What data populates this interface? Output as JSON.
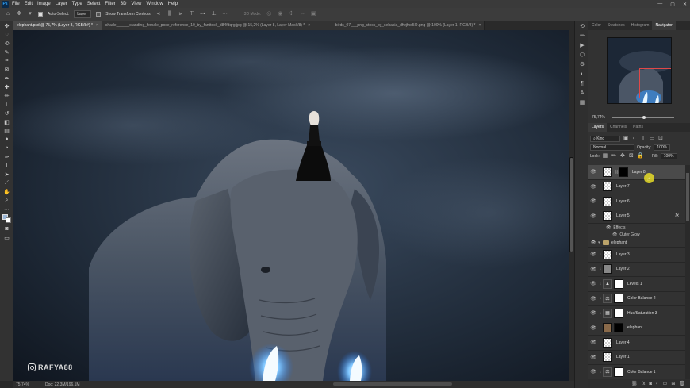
{
  "menubar": {
    "logo": "Ps",
    "items": [
      "File",
      "Edit",
      "Image",
      "Layer",
      "Type",
      "Select",
      "Filter",
      "3D",
      "View",
      "Window",
      "Help"
    ],
    "window_controls": [
      "—",
      "▢",
      "✕"
    ]
  },
  "options": {
    "auto_select_label": "Auto-Select:",
    "auto_select_target": "Layer",
    "show_transform_label": "Show Transform Controls",
    "mode_3d_label": "3D Mode:"
  },
  "tabs": [
    {
      "label": "elephant.psd @ 75,7% (Layer 8, RGB/8#) *",
      "active": true
    },
    {
      "label": "shade______standing_female_pose_reference_10_by_fanttock_d84fdqrg.jpg @ 15,2% (Layer 8, Layer Mask/8) *",
      "active": false
    },
    {
      "label": "birds_07___png_stock_by_sebasia_dfwjfnd5O.png @ 100% (Layer 1, RGB/8) *",
      "active": false
    }
  ],
  "status": {
    "zoom": "75,74%",
    "doc": "Doc: 22,3M/196,1M"
  },
  "watermark": {
    "text": "RAFYA88"
  },
  "panels": {
    "top_tabs": [
      "Color",
      "Swatches",
      "Histogram",
      "Navigator"
    ],
    "active_top_tab": "Navigator",
    "navigator_zoom": "75,74%",
    "layer_tabs": [
      "Layers",
      "Channels",
      "Paths"
    ],
    "active_layer_tab": "Layers",
    "kind_label": "Kind",
    "blend_mode": "Normal",
    "opacity_label": "Opacity:",
    "opacity_value": "100%",
    "lock_label": "Lock:",
    "fill_label": "Fill:",
    "fill_value": "100%"
  },
  "layers": [
    {
      "name": "Layer 8",
      "thumb": "checker",
      "mask": "black",
      "selected": true
    },
    {
      "name": "Layer 7",
      "thumb": "checker"
    },
    {
      "name": "Layer 6",
      "thumb": "checker"
    },
    {
      "name": "Layer 5",
      "thumb": "checker",
      "fx": "fx"
    }
  ],
  "effects": {
    "label": "Effects",
    "items": [
      "Outer Glow"
    ]
  },
  "group": {
    "name": "elephant"
  },
  "group_layers": [
    {
      "name": "Layer 3",
      "thumb": "checker"
    },
    {
      "name": "Layer 2",
      "thumb": "gray"
    },
    {
      "name": "Levels 1",
      "thumb": "adj",
      "glyph": "▲",
      "mask": "white"
    },
    {
      "name": "Color Balance 2",
      "thumb": "adj",
      "glyph": "⚖",
      "mask": "white"
    },
    {
      "name": "Hue/Saturation 3",
      "thumb": "adj",
      "glyph": "▦",
      "mask": "white"
    },
    {
      "name": "elephant",
      "thumb": "ele",
      "mask": "black"
    }
  ],
  "bottom_layers": [
    {
      "name": "Layer 4",
      "thumb": "checker"
    },
    {
      "name": "Layer 1",
      "thumb": "checker"
    },
    {
      "name": "Color Balance 1",
      "thumb": "adj",
      "glyph": "⚖",
      "mask": "white"
    }
  ],
  "icons": {
    "eye": "👁",
    "fx": "fx"
  }
}
